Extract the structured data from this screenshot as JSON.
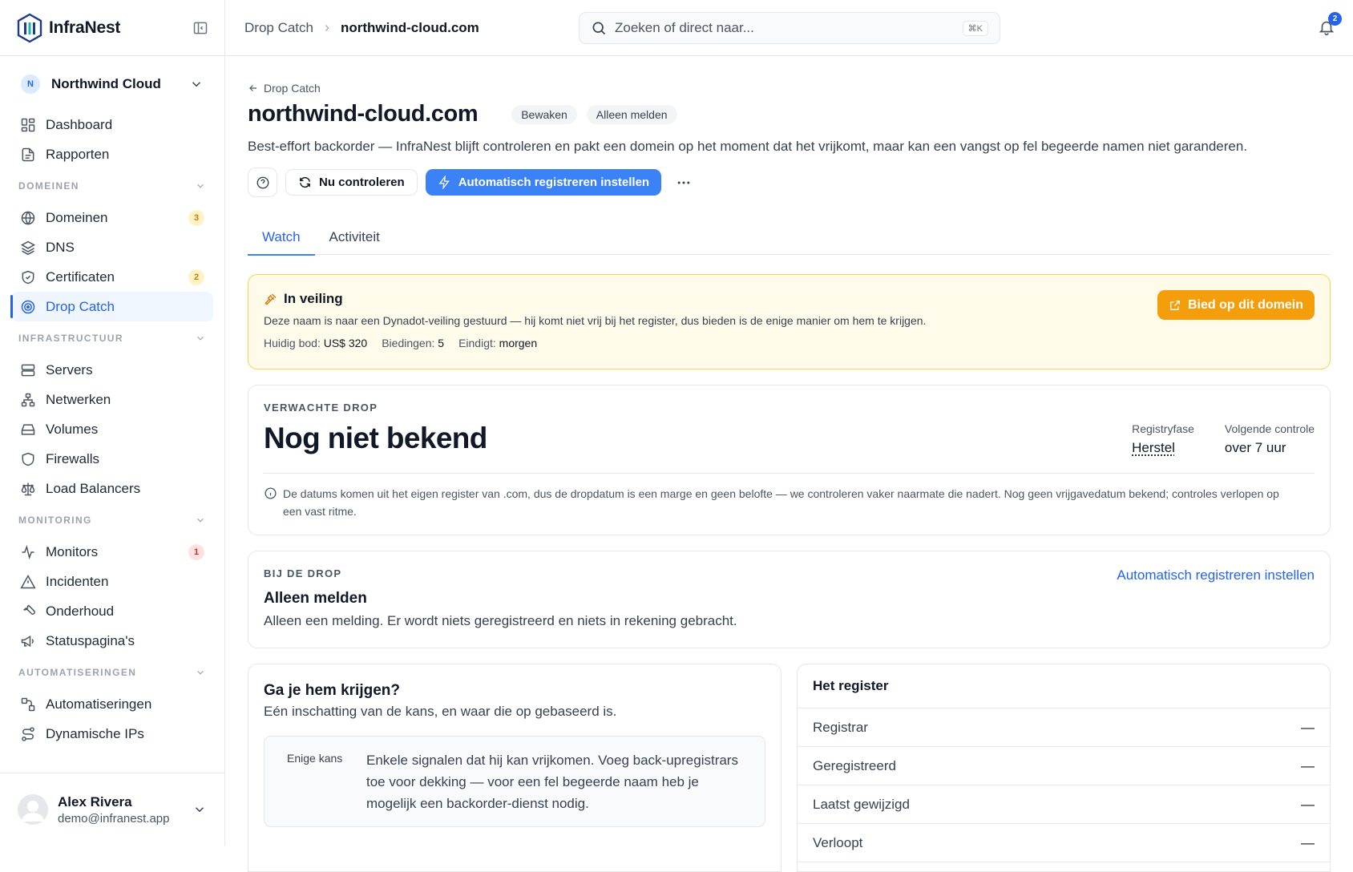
{
  "brand": {
    "name": "InfraNest"
  },
  "org": {
    "initial": "N",
    "name": "Northwind Cloud"
  },
  "nav": {
    "top": [
      {
        "label": "Dashboard",
        "icon": "dashboard-icon"
      },
      {
        "label": "Rapporten",
        "icon": "report-icon"
      }
    ],
    "sections": [
      {
        "title": "DOMEINEN",
        "items": [
          {
            "label": "Domeinen",
            "icon": "globe-icon",
            "badge": "3",
            "badge_color": "amber"
          },
          {
            "label": "DNS",
            "icon": "layers-icon"
          },
          {
            "label": "Certificaten",
            "icon": "shield-check-icon",
            "badge": "2",
            "badge_color": "amber"
          },
          {
            "label": "Drop Catch",
            "icon": "target-icon",
            "active": true
          }
        ]
      },
      {
        "title": "INFRASTRUCTUUR",
        "items": [
          {
            "label": "Servers",
            "icon": "server-icon"
          },
          {
            "label": "Netwerken",
            "icon": "network-icon"
          },
          {
            "label": "Volumes",
            "icon": "hard-drive-icon"
          },
          {
            "label": "Firewalls",
            "icon": "shield-icon"
          },
          {
            "label": "Load Balancers",
            "icon": "scale-icon"
          }
        ]
      },
      {
        "title": "MONITORING",
        "items": [
          {
            "label": "Monitors",
            "icon": "activity-icon",
            "badge": "1",
            "badge_color": "red"
          },
          {
            "label": "Incidenten",
            "icon": "alert-triangle-icon"
          },
          {
            "label": "Onderhoud",
            "icon": "wrench-icon"
          },
          {
            "label": "Statuspagina's",
            "icon": "megaphone-icon"
          }
        ]
      },
      {
        "title": "AUTOMATISERINGEN",
        "items": [
          {
            "label": "Automatiseringen",
            "icon": "workflow-icon"
          },
          {
            "label": "Dynamische IPs",
            "icon": "route-icon"
          }
        ]
      }
    ]
  },
  "user": {
    "name": "Alex Rivera",
    "email": "demo@infranest.app"
  },
  "topbar": {
    "crumb_parent": "Drop Catch",
    "crumb_current": "northwind-cloud.com",
    "search_placeholder": "Zoeken of direct naar...",
    "search_kbd": "⌘K",
    "notifications": "2"
  },
  "page": {
    "back": "Drop Catch",
    "title": "northwind-cloud.com",
    "pills": [
      "Bewaken",
      "Alleen melden"
    ],
    "description": "Best-effort backorder — InfraNest blijft controleren en pakt een domein op het moment dat het vrijkomt, maar kan een vangst op fel begeerde namen niet garanderen.",
    "btn_check": "Nu controleren",
    "btn_auto": "Automatisch registreren instellen",
    "tabs": [
      "Watch",
      "Activiteit"
    ]
  },
  "auction": {
    "title": "In veiling",
    "text": "Deze naam is naar een Dynadot-veiling gestuurd — hij komt niet vrij bij het register, dus bieden is de enige manier om hem te krijgen.",
    "bid_label": "Huidig bod:",
    "bid_value": "US$ 320",
    "bids_label": "Biedingen:",
    "bids_value": "5",
    "ends_label": "Eindigt:",
    "ends_value": "morgen",
    "button": "Bied op dit domein"
  },
  "drop": {
    "kicker": "VERWACHTE DROP",
    "value": "Nog niet bekend",
    "phase_label": "Registryfase",
    "phase_value": "Herstel",
    "next_label": "Volgende controle",
    "next_value": "over 7 uur",
    "note": "De datums komen uit het eigen register van .com, dus de dropdatum is een marge en geen belofte — we controleren vaker naarmate die nadert. Nog geen vrijgavedatum bekend; controles verlopen op een vast ritme."
  },
  "atdrop": {
    "kicker": "BIJ DE DROP",
    "title": "Alleen melden",
    "text": "Alleen een melding. Er wordt niets geregistreerd en niets in rekening gebracht.",
    "link": "Automatisch registreren instellen"
  },
  "chance": {
    "title": "Ga je hem krijgen?",
    "subtitle": "Eén inschatting van de kans, en waar die op gebaseerd is.",
    "key": "Enige kans",
    "value": "Enkele signalen dat hij kan vrijkomen. Voeg back-upregistrars toe voor dekking — voor een fel begeerde naam heb je mogelijk een backorder-dienst nodig."
  },
  "registry": {
    "title": "Het register",
    "rows": [
      {
        "label": "Registrar",
        "value": "—"
      },
      {
        "label": "Geregistreerd",
        "value": "—"
      },
      {
        "label": "Laatst gewijzigd",
        "value": "—"
      },
      {
        "label": "Verloopt",
        "value": "—"
      }
    ]
  }
}
